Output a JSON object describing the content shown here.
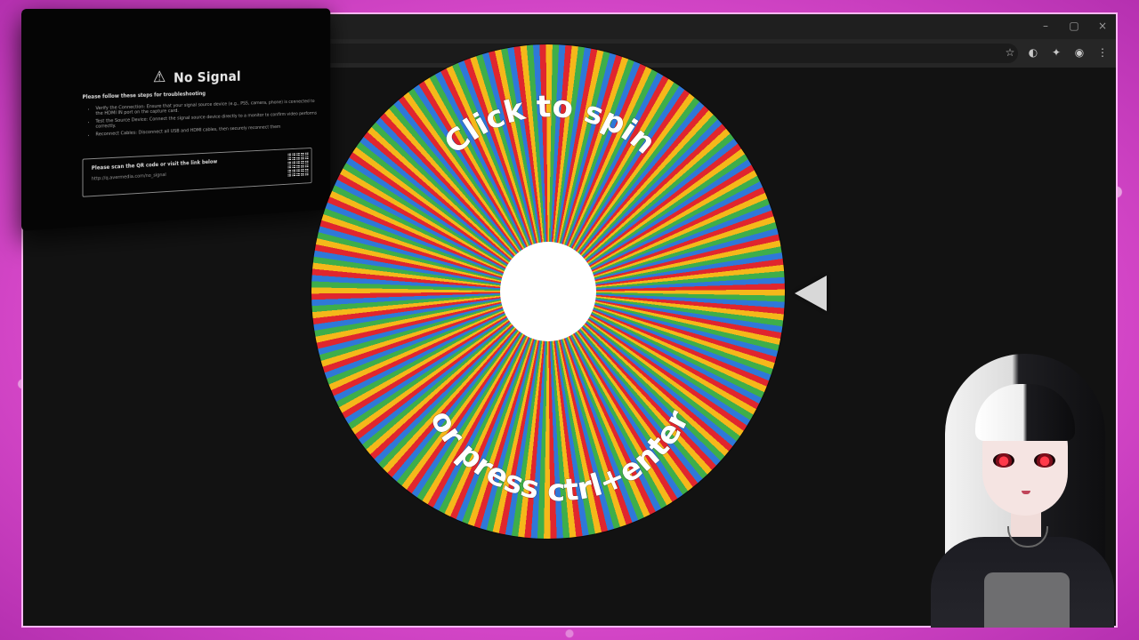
{
  "browser": {
    "window_controls": [
      "–",
      "▢",
      "×"
    ],
    "toolbar_icons": [
      "star-icon",
      "extension-icon",
      "puzzle-icon",
      "profile-icon",
      "menu-icon"
    ]
  },
  "no_signal": {
    "title": "No Signal",
    "heading": "Please follow these steps for troubleshooting",
    "steps": [
      "Verify the Connection: Ensure that your signal source device (e.g., PS5, camera, phone) is connected to the HDMI IN port on the capture card.",
      "Test the Source Device: Connect the signal source device directly to a monitor to confirm video performs correctly.",
      "Reconnect Cables: Disconnect all USB and HDMI cables, then securely reconnect them"
    ],
    "qr_prompt": "Please scan the QR code or visit the link below",
    "link": "http://q.avermedia.com/no_signal"
  },
  "wheel": {
    "top_text": "Click to spin",
    "bottom_text": "or press ctrl+enter",
    "colors": [
      "#e0262e",
      "#f5b81a",
      "#3eae4a",
      "#2f78d8"
    ]
  }
}
